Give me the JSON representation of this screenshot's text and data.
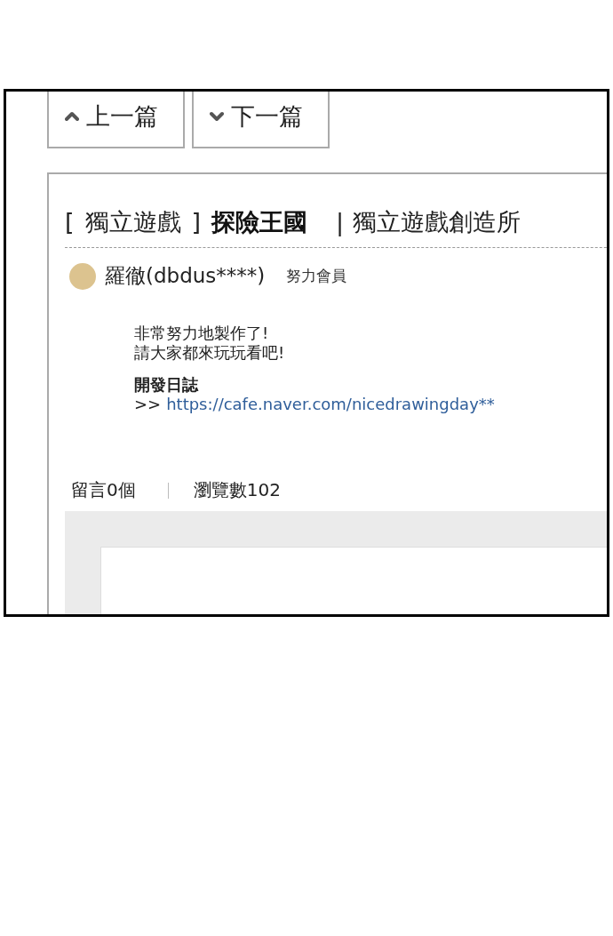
{
  "nav_buttons": [
    {
      "label": "上一篇",
      "kind": "up"
    },
    {
      "label": "下一篇",
      "kind": "down"
    }
  ],
  "post": {
    "bracket_open": "[",
    "category": "獨立遊戲",
    "bracket_close": "]",
    "title": "探險王國",
    "separator": "|",
    "board": "獨立遊戲創造所",
    "author": {
      "name": "羅徹(dbdus****)",
      "rank": "努力會員"
    },
    "body_lines": [
      "非常努力地製作了!",
      "請大家都來玩玩看吧!"
    ],
    "devlog_label": "開發日誌",
    "link_prefix": ">>",
    "link": "https://cafe.naver.com/nicedrawingday**"
  },
  "stats": {
    "comments": "留言0個",
    "views": "瀏覽數102"
  }
}
